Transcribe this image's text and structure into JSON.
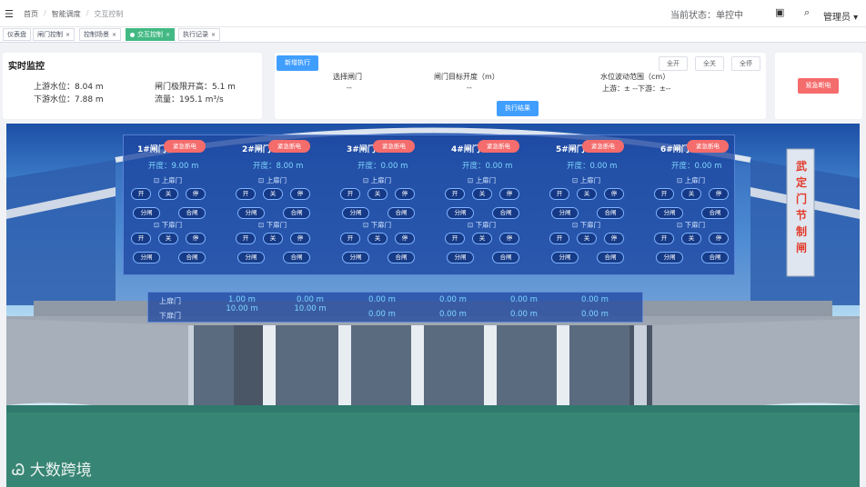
{
  "header": {
    "breadcrumb": [
      "首页",
      "智能调度",
      "交互控制"
    ],
    "status_label": "当前状态：",
    "status_value": "单控中",
    "user": "管理员"
  },
  "tabs": [
    {
      "label": "仪表盘",
      "closable": false
    },
    {
      "label": "闸门控制",
      "closable": true
    },
    {
      "label": "控制场景",
      "closable": true
    },
    {
      "label": "交互控制",
      "closable": true,
      "active": true
    },
    {
      "label": "执行记录",
      "closable": true
    }
  ],
  "monitor": {
    "title": "实时监控",
    "upstream": "上游水位：8.04 m",
    "downstream": "下游水位：7.88 m",
    "limit_open": "闸门极限开高：5.1 m",
    "flow": "流量：195.1 m³/s"
  },
  "exec": {
    "new_btn": "新增执行",
    "col_select": "选择闸门",
    "col_target": "闸门目标开度（m）",
    "col_range": "水位波动范围（cm）",
    "select_val": "--",
    "target_val": "--",
    "range_val": "上游：± --下游：±--",
    "open_all": "全开",
    "close_all": "全关",
    "stop_all": "全停",
    "result_btn": "执行结果"
  },
  "emergency_top": "紧急断电",
  "banner_text": "武定门节制闸",
  "watermark": "大数跨境",
  "gates": [
    {
      "name": "1#闸门",
      "opening": "开度：9.00 m"
    },
    {
      "name": "2#闸门",
      "opening": "开度：8.00 m"
    },
    {
      "name": "3#闸门",
      "opening": "开度：0.00 m"
    },
    {
      "name": "4#闸门",
      "opening": "开度：0.00 m"
    },
    {
      "name": "5#闸门",
      "opening": "开度：0.00 m"
    },
    {
      "name": "6#闸门",
      "opening": "开度：0.00 m"
    }
  ],
  "gate_labels": {
    "emergency": "紧急断电",
    "upper": "上扉门",
    "lower": "下扉门",
    "open": "开",
    "close": "关",
    "stop": "停",
    "split": "分闸",
    "merge": "合闸"
  },
  "levels": {
    "upper_label": "上扉门",
    "lower_label": "下扉门",
    "upper": [
      "1.00 m",
      "0.00 m",
      "0.00 m",
      "0.00 m",
      "0.00 m",
      "0.00 m"
    ],
    "lower": [
      "10.00 m",
      "10.00 m",
      "0.00 m",
      "0.00 m",
      "0.00 m",
      "0.00 m"
    ]
  }
}
